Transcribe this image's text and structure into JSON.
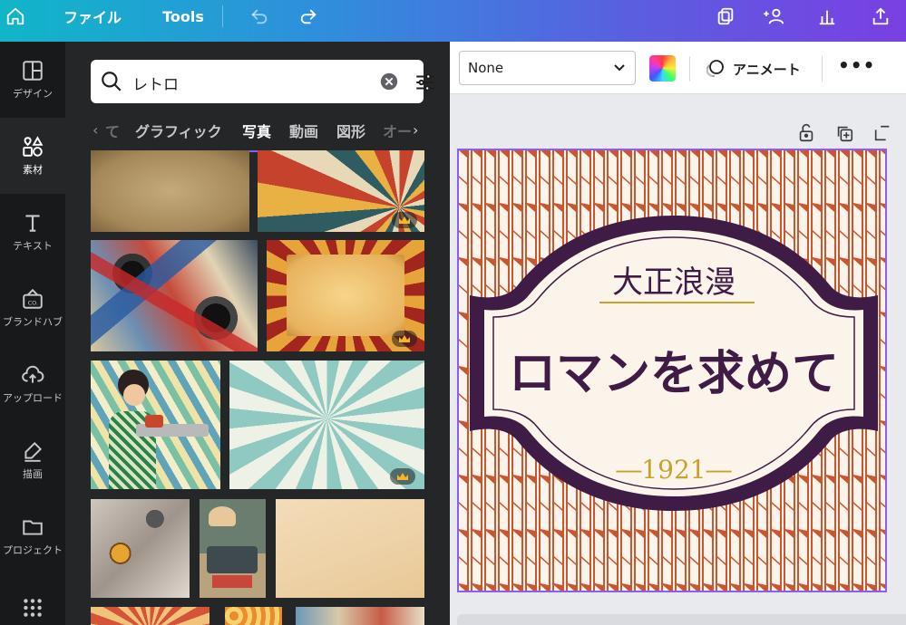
{
  "topbar": {
    "menu_file": "ファイル",
    "menu_tools": "Tools",
    "icons": [
      "home-icon",
      "undo-icon",
      "redo-icon",
      "copy-pages-icon",
      "share-users-icon",
      "chart-icon",
      "upload-icon"
    ]
  },
  "rail": {
    "items": [
      {
        "label": "デザイン",
        "icon": "layout-icon",
        "active": false
      },
      {
        "label": "素材",
        "icon": "elements-icon",
        "active": true
      },
      {
        "label": "テキスト",
        "icon": "text-icon",
        "active": false
      },
      {
        "label": "ブランドハブ",
        "icon": "brand-icon",
        "active": false
      },
      {
        "label": "アップロード",
        "icon": "upload-cloud-icon",
        "active": false
      },
      {
        "label": "描画",
        "icon": "draw-icon",
        "active": false
      },
      {
        "label": "プロジェクト",
        "icon": "folder-icon",
        "active": false
      },
      {
        "label": "",
        "icon": "apps-grid-icon",
        "active": false
      }
    ]
  },
  "search": {
    "value": "レトロ"
  },
  "tabs": {
    "items": [
      "グラフィック",
      "写真",
      "動画",
      "図形",
      "オー"
    ],
    "active": "写真",
    "prev_partial": "て"
  },
  "editor": {
    "animation_select": "None",
    "animate_label": "アニメート"
  },
  "design": {
    "subtitle": "大正浪漫",
    "headline": "ロマンを求めて",
    "year": "―1921―"
  },
  "colors": {
    "accent": "#8b5cf6",
    "panel_bg": "#252627",
    "rail_bg": "#18191b",
    "canvas_bg": "#e9eaee",
    "frame_purple": "#3e1c45",
    "pattern_orange": "#c9562e",
    "cream": "#fbf4ea",
    "gold": "#c9a227"
  }
}
